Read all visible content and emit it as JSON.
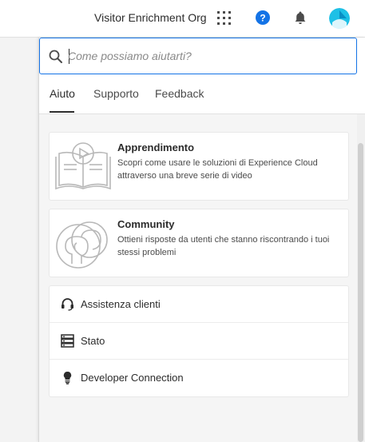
{
  "header": {
    "org_name": "Visitor Enrichment Org",
    "icons": [
      "apps-grid-icon",
      "help-icon",
      "bell-icon",
      "avatar"
    ],
    "help_color": "#1473e6"
  },
  "search": {
    "placeholder": "Come possiamo aiutarti?",
    "value": ""
  },
  "tabs": [
    {
      "label": "Aiuto",
      "active": true
    },
    {
      "label": "Supporto",
      "active": false
    },
    {
      "label": "Feedback",
      "active": false
    }
  ],
  "cards": [
    {
      "title": "Apprendimento",
      "description": "Scopri come usare le soluzioni di Experience Cloud attraverso una breve serie di video",
      "icon": "open-book-play-icon"
    },
    {
      "title": "Community",
      "description": "Ottieni risposte da utenti che stanno riscontrando i tuoi stessi problemi",
      "icon": "community-heads-icon"
    }
  ],
  "links": [
    {
      "label": "Assistenza clienti",
      "icon": "headset-icon"
    },
    {
      "label": "Stato",
      "icon": "server-status-icon"
    },
    {
      "label": "Developer Connection",
      "icon": "lightbulb-icon"
    }
  ],
  "colors": {
    "accent": "#1473e6",
    "avatar": "#1ec0e6"
  }
}
